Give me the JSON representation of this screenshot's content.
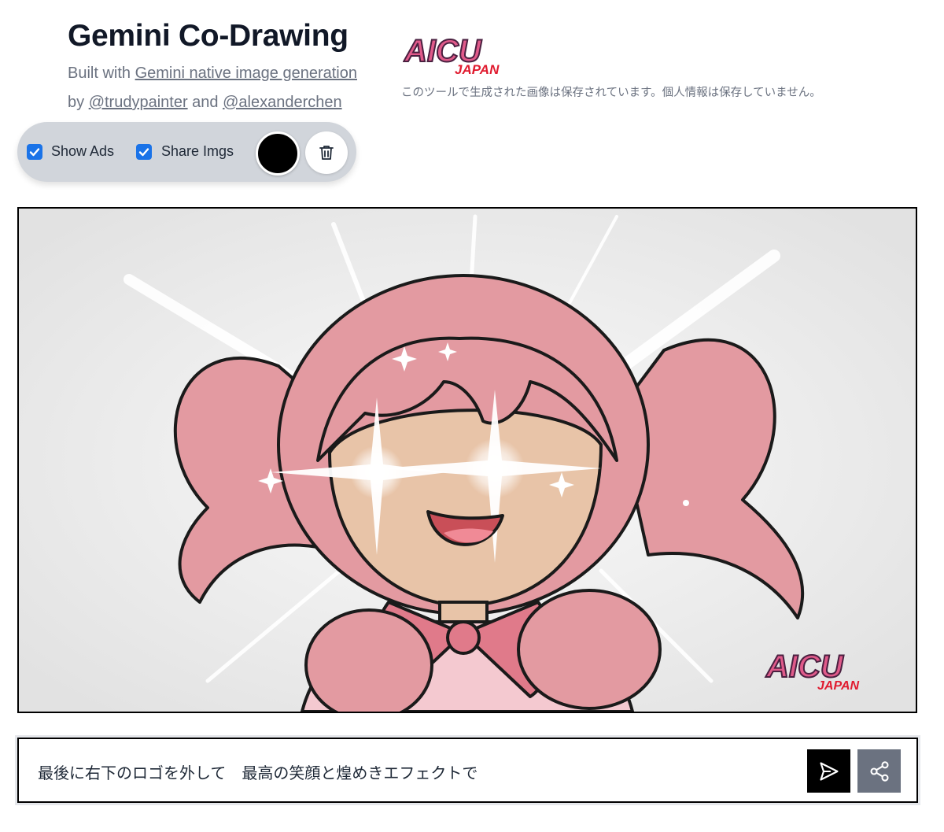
{
  "header": {
    "title": "Gemini Co-Drawing",
    "built_with_prefix": "Built with ",
    "built_with_link": "Gemini native image generation",
    "by_prefix": "by ",
    "author1": "@trudypainter",
    "and_text": " and ",
    "author2": "@alexanderchen"
  },
  "brand": {
    "logo_main": "AICU",
    "logo_sub": "JAPAN",
    "note": "このツールで生成された画像は保存されています。個人情報は保存していません。"
  },
  "toolbar": {
    "show_ads_label": "Show Ads",
    "show_ads_checked": true,
    "share_imgs_label": "Share Imgs",
    "share_imgs_checked": true,
    "pen_color": "#000000",
    "trash_icon": "trash-icon"
  },
  "canvas": {
    "watermark_main": "AICU",
    "watermark_sub": "JAPAN"
  },
  "prompt": {
    "value": "最後に右下のロゴを外して　最高の笑顔と煌めきエフェクトで"
  },
  "colors": {
    "accent_pink": "#e05a8a",
    "logo_red": "#e01b2f",
    "hair_pink": "#e39aa1",
    "skin": "#e8c4a8",
    "checkbox_blue": "#1a73e8",
    "share_gray": "#6b7280"
  }
}
